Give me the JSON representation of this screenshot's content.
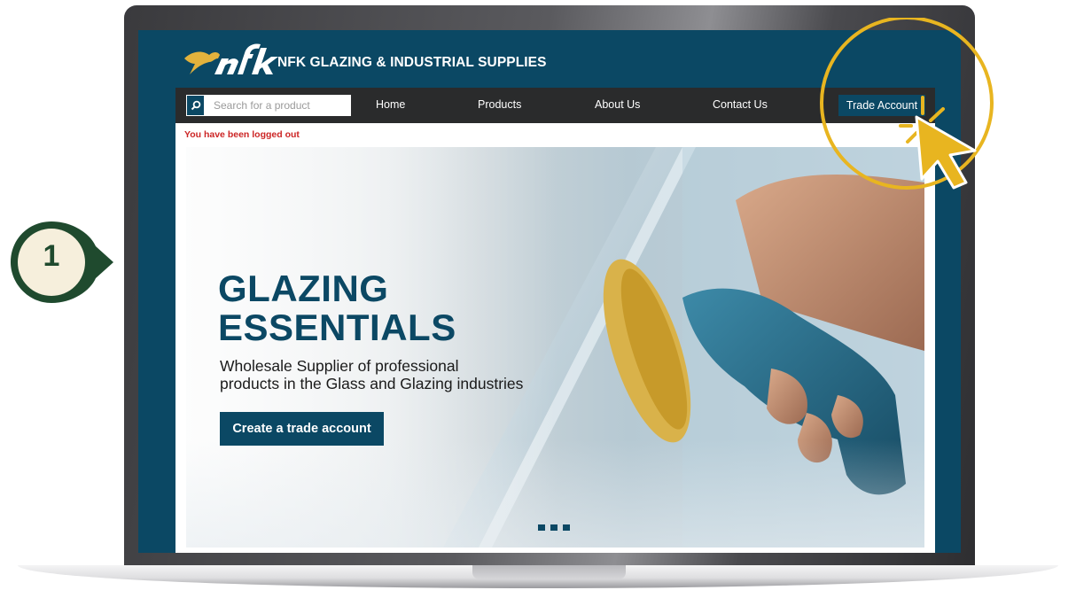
{
  "header": {
    "brand_name": "NFK GLAZING & INDUSTRIAL SUPPLIES",
    "logo_text": "nfk"
  },
  "search": {
    "placeholder": "Search for a product",
    "value": ""
  },
  "nav": {
    "items": [
      {
        "label": "Home"
      },
      {
        "label": "Products"
      },
      {
        "label": "About Us"
      },
      {
        "label": "Contact Us"
      }
    ],
    "trade_account_label": "Trade Account"
  },
  "status": {
    "logout_message": "You have been logged out"
  },
  "hero": {
    "title_line1": "GLAZING",
    "title_line2": "ESSENTIALS",
    "subtitle_line1": "Wholesale Supplier of professional",
    "subtitle_line2": "products in the Glass and Glazing industries",
    "cta_label": "Create a trade account",
    "slide_count": 3
  },
  "tutorial": {
    "step_number": "1"
  },
  "colors": {
    "brand_navy": "#0b4864",
    "nav_dark": "#2a2b2c",
    "alert_red": "#cc2525",
    "highlight_gold": "#e8b520",
    "step_green": "#1f4a2e",
    "step_cream": "#f6efdc"
  },
  "icons": {
    "search": "search-icon",
    "cursor": "pointer-cursor-icon",
    "logo": "kangaroo-logo-icon"
  }
}
